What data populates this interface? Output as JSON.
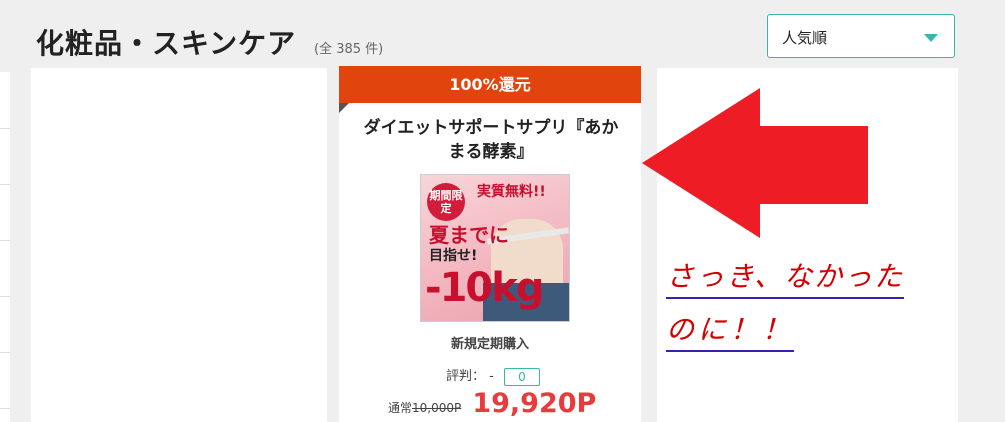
{
  "header": {
    "title": "化粧品・スキンケア",
    "count": "(全 385 件)"
  },
  "sort": {
    "selected": "人気順",
    "accent_color": "#3ab5a8"
  },
  "product": {
    "cashback_banner": "100%還元",
    "banner_color": "#e2440e",
    "title": "ダイエットサポートサプリ『あかまる酵素』",
    "image": {
      "badge": "期間限定",
      "tagline": "実質無料!!",
      "headline": "夏までに",
      "goal": "目指せ!",
      "weight": "-10kg"
    },
    "subscription_label": "新規定期購入",
    "rating_label": "評判：",
    "rating_value": "-",
    "review_count": "0",
    "regular_label": "通常",
    "regular_price": "10,000P",
    "point_price": "19,920P",
    "price_color": "#e83b3b"
  },
  "annotation": {
    "line1": "さっき、なかった",
    "line2": "のに！！",
    "text_color": "#d40000",
    "arrow_color": "#ee1c25"
  }
}
